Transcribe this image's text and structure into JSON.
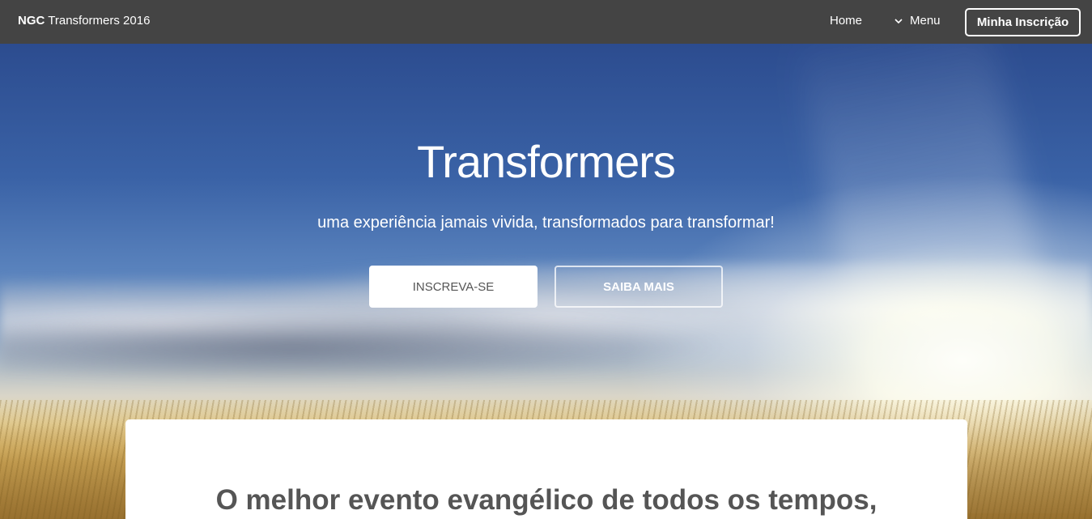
{
  "header": {
    "brand_strong": "NGC",
    "brand_rest": "Transformers 2016",
    "nav": {
      "home": "Home",
      "menu": "Menu"
    },
    "cta": "Minha Inscrição"
  },
  "hero": {
    "title": "Transformers",
    "subtitle": "uma experiência jamais vivida, transformados para transformar!",
    "primary_button": "INSCREVA-SE",
    "secondary_button": "SAIBA MAIS"
  },
  "content": {
    "heading": "O melhor evento evangélico de todos os tempos,"
  },
  "colors": {
    "header_bg": "#444444",
    "text_light": "#ffffff",
    "text_dark": "#555555"
  },
  "icons": {
    "menu": "chevron-down-icon"
  }
}
